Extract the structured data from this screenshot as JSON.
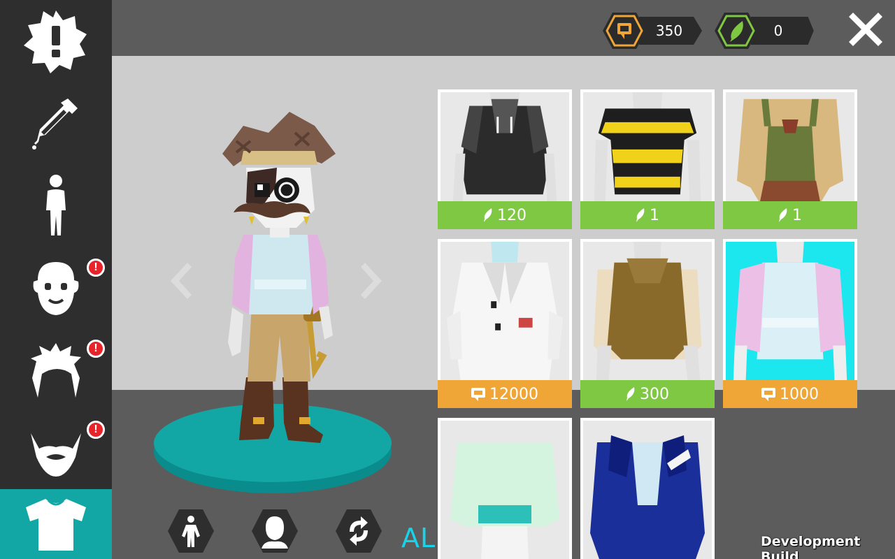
{
  "sidebar": {
    "items": [
      {
        "name": "alert",
        "icon": "alert-badge-icon",
        "badge": ""
      },
      {
        "name": "color-picker",
        "icon": "eyedropper-icon",
        "badge": ""
      },
      {
        "name": "body",
        "icon": "body-silhouette-icon",
        "badge": ""
      },
      {
        "name": "face",
        "icon": "face-icon",
        "badge": "!"
      },
      {
        "name": "hair",
        "icon": "hair-icon",
        "badge": "!"
      },
      {
        "name": "beard",
        "icon": "beard-icon",
        "badge": "!"
      },
      {
        "name": "shirt",
        "icon": "shirt-icon",
        "badge": "",
        "active": true
      }
    ]
  },
  "currencies": {
    "coins": {
      "value": "350",
      "icon": "coin-screen-icon",
      "color": "#f0a636"
    },
    "feathers": {
      "value": "0",
      "icon": "feather-icon",
      "color": "#7ec843"
    }
  },
  "controls": {
    "close_icon": "close-icon",
    "prev_icon": "chevron-left-icon",
    "next_icon": "chevron-right-icon",
    "bottom": [
      "full-body-view-icon",
      "head-view-icon",
      "rotate-icon"
    ]
  },
  "overlay": {
    "alpha": "ALPHA",
    "dev_build": "Development Build"
  },
  "items": [
    {
      "name": "black-hoodie-vest",
      "price": "120",
      "currency": "feather"
    },
    {
      "name": "bee-striped-shirt",
      "price": "1",
      "currency": "feather"
    },
    {
      "name": "green-overalls",
      "price": "1",
      "currency": "feather"
    },
    {
      "name": "white-lab-coat",
      "price": "12000",
      "currency": "coin"
    },
    {
      "name": "brown-hooded-vest",
      "price": "300",
      "currency": "feather"
    },
    {
      "name": "pink-cardigan",
      "price": "1000",
      "currency": "coin",
      "selected": true
    },
    {
      "name": "mint-sweater",
      "price": "",
      "currency": ""
    },
    {
      "name": "blue-jacket",
      "price": "",
      "currency": ""
    }
  ],
  "colors": {
    "accent": "#12a7a5",
    "feather_price": "#7ec843",
    "coin_price": "#f0a636",
    "selected_bg": "#1ce7ef",
    "badge": "#e8242a"
  }
}
